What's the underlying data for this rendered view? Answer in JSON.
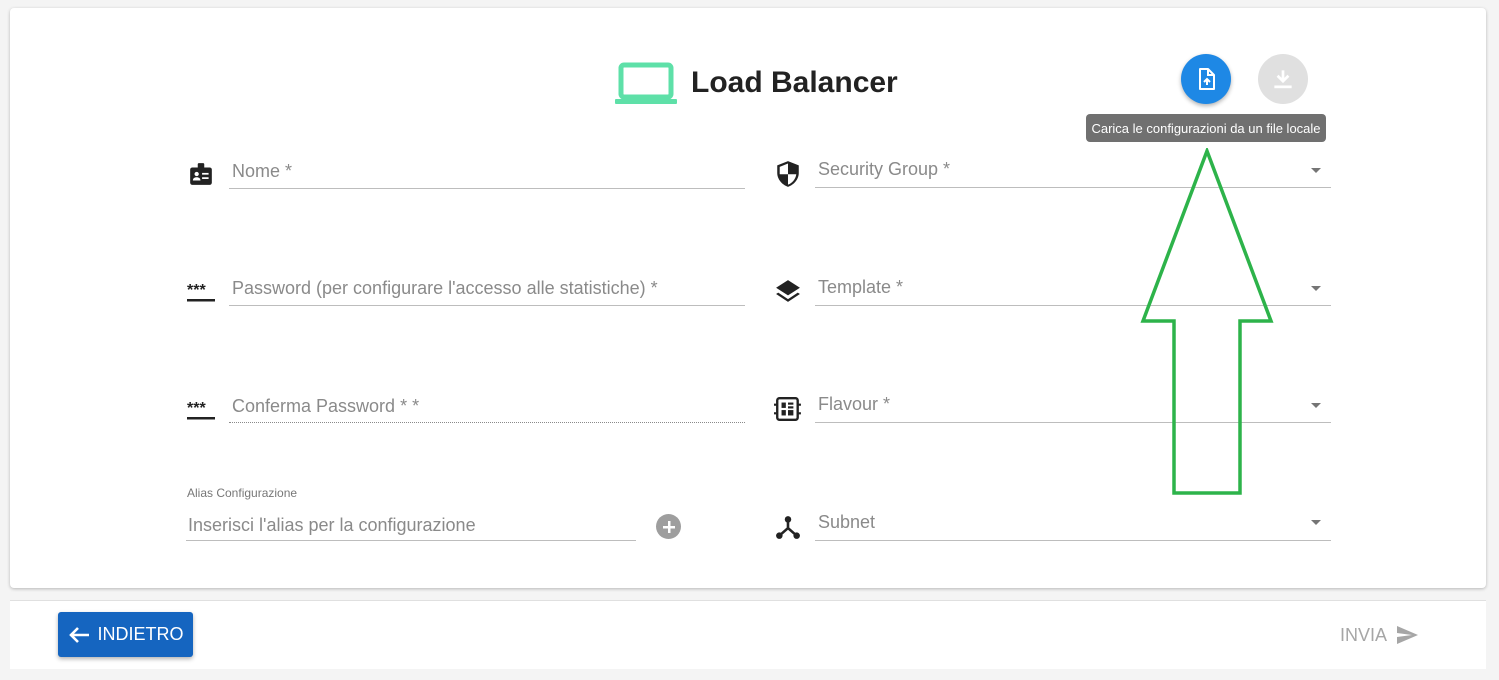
{
  "header": {
    "title": "Load Balancer",
    "icon": "laptop-icon",
    "icon_color": "#5ee0a8"
  },
  "actions": {
    "upload_icon": "upload-file-icon",
    "download_icon": "download-icon",
    "upload_tooltip": "Carica le configurazioni da un file locale",
    "upload_color": "#1e88e5"
  },
  "form": {
    "left": {
      "nome": {
        "label": "Nome *",
        "icon": "id-badge-icon"
      },
      "password": {
        "label": "Password (per configurare l'accesso alle statistiche) *",
        "icon": "password-icon"
      },
      "confirm_password": {
        "label": "Conferma Password * *",
        "icon": "password-icon"
      },
      "alias": {
        "label": "Alias Configurazione",
        "placeholder": "Inserisci l'alias per la configurazione",
        "add_icon": "add-circle-icon"
      }
    },
    "right": {
      "security_group": {
        "label": "Security Group *",
        "icon": "shield-icon"
      },
      "template": {
        "label": "Template *",
        "icon": "layers-icon"
      },
      "flavour": {
        "label": "Flavour *",
        "icon": "chip-icon"
      },
      "subnet": {
        "label": "Subnet",
        "icon": "network-icon"
      }
    }
  },
  "annotation": {
    "arrow_color": "#2db34a"
  },
  "footer": {
    "back_label": "INDIETRO",
    "back_color": "#1565c0",
    "send_label": "INVIA"
  }
}
